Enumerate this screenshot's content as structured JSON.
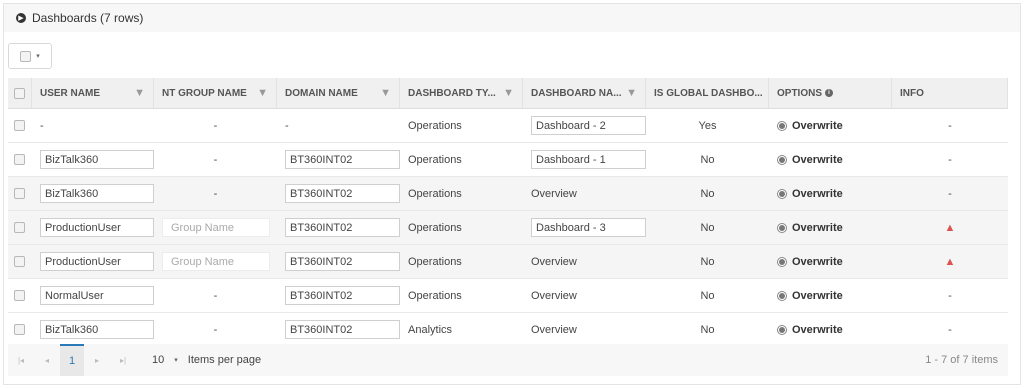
{
  "panel": {
    "title": "Dashboards (7 rows)",
    "toggle_icon": "chevron-right-circle-icon"
  },
  "bulk": {
    "caret": "▾"
  },
  "columns": {
    "user_name": "USER NAME",
    "nt_group": "NT GROUP NAME",
    "domain": "DOMAIN NAME",
    "dash_type": "DASHBOARD TY...",
    "dash_name": "DASHBOARD NA...",
    "is_global": "IS GLOBAL DASHBO...",
    "options": "OPTIONS",
    "info": "INFO"
  },
  "rows": [
    {
      "user": "-",
      "nt": "-",
      "domain": "-",
      "type": "Operations",
      "dname": "Dashboard - 2",
      "global": "Yes",
      "option": "Overwrite",
      "info": "-",
      "user_input": false,
      "nt_input": false,
      "domain_input": false,
      "dname_input": true,
      "warn": false
    },
    {
      "user": "BizTalk360",
      "nt": "-",
      "domain": "BT360INT02",
      "type": "Operations",
      "dname": "Dashboard - 1",
      "global": "No",
      "option": "Overwrite",
      "info": "-",
      "user_input": true,
      "nt_input": false,
      "domain_input": true,
      "dname_input": true,
      "warn": false
    },
    {
      "user": "BizTalk360",
      "nt": "-",
      "domain": "BT360INT02",
      "type": "Operations",
      "dname": "Overview",
      "global": "No",
      "option": "Overwrite",
      "info": "-",
      "user_input": true,
      "nt_input": false,
      "domain_input": true,
      "dname_input": false,
      "warn": false
    },
    {
      "user": "ProductionUser",
      "nt": "Group Name",
      "domain": "BT360INT02",
      "type": "Operations",
      "dname": "Dashboard - 3",
      "global": "No",
      "option": "Overwrite",
      "info": "",
      "user_input": true,
      "nt_input": true,
      "domain_input": true,
      "dname_input": true,
      "warn": true
    },
    {
      "user": "ProductionUser",
      "nt": "Group Name",
      "domain": "BT360INT02",
      "type": "Operations",
      "dname": "Overview",
      "global": "No",
      "option": "Overwrite",
      "info": "",
      "user_input": true,
      "nt_input": true,
      "domain_input": true,
      "dname_input": false,
      "warn": true
    },
    {
      "user": "NormalUser",
      "nt": "-",
      "domain": "BT360INT02",
      "type": "Operations",
      "dname": "Overview",
      "global": "No",
      "option": "Overwrite",
      "info": "-",
      "user_input": true,
      "nt_input": false,
      "domain_input": true,
      "dname_input": false,
      "warn": false
    },
    {
      "user": "BizTalk360",
      "nt": "-",
      "domain": "BT360INT02",
      "type": "Analytics",
      "dname": "Overview",
      "global": "No",
      "option": "Overwrite",
      "info": "-",
      "user_input": true,
      "nt_input": false,
      "domain_input": true,
      "dname_input": false,
      "warn": false
    }
  ],
  "pager": {
    "first": "|◂",
    "prev": "◂",
    "current_page": "1",
    "next": "▸",
    "last": "▸|",
    "page_size": "10",
    "page_size_caret": "▾",
    "items_per_page": "Items per page",
    "range": "1 - 7 of 7 items"
  },
  "colors": {
    "accent": "#2a7ab8",
    "warning": "#d9534f"
  }
}
